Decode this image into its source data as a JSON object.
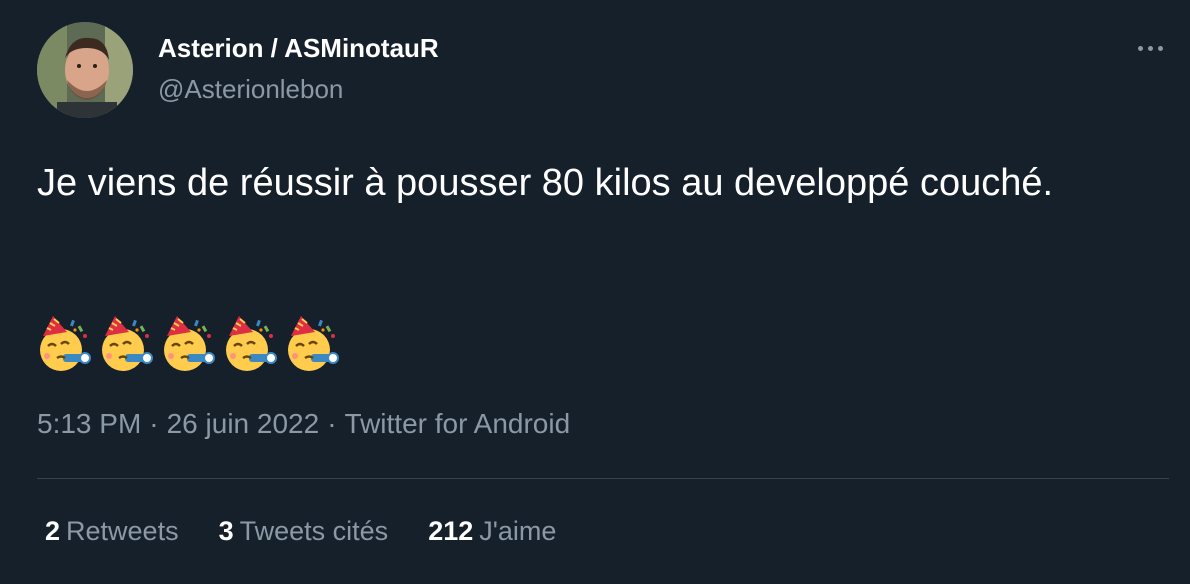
{
  "author": {
    "display_name": "Asterion / ASMinotauR",
    "handle": "@Asterionlebon"
  },
  "tweet": {
    "text": "Je viens de réussir à pousser 80 kilos au developpé couché.",
    "emoji": [
      "partying-face",
      "partying-face",
      "partying-face",
      "partying-face",
      "partying-face"
    ]
  },
  "meta": {
    "time": "5:13 PM",
    "separator": "·",
    "date": "26 juin 2022",
    "source": "Twitter for Android"
  },
  "stats": {
    "retweets_count": "2",
    "retweets_label": "Retweets",
    "quotes_count": "3",
    "quotes_label": "Tweets cités",
    "likes_count": "212",
    "likes_label": "J'aime"
  },
  "colors": {
    "background": "#15202b",
    "secondary_text": "#8b98a5",
    "divider": "#38444d"
  }
}
